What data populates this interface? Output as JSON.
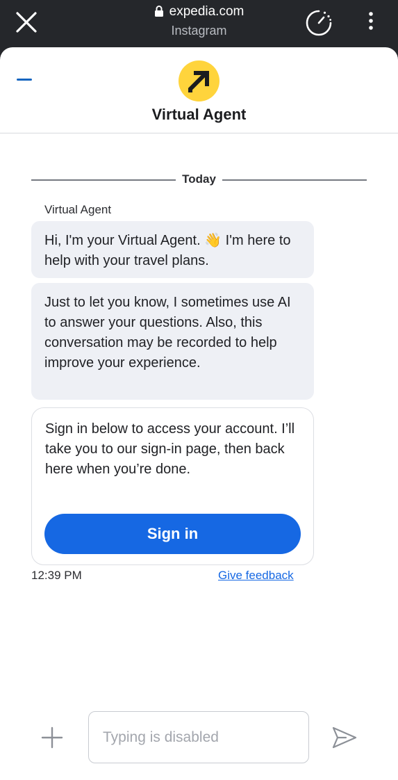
{
  "browser": {
    "domain": "expedia.com",
    "source_app": "Instagram"
  },
  "header": {
    "title": "Virtual Agent",
    "brand_color": "#ffd43c",
    "accent_color": "#1668e3"
  },
  "chat": {
    "date_divider": "Today",
    "sender_name": "Virtual Agent",
    "messages": [
      {
        "text": "Hi, I'm your Virtual Agent. 👋 I'm here to help with your travel plans."
      },
      {
        "text": "Just to let you know, I sometimes use AI to answer your questions. Also, this conversation may be recorded to help improve your experience."
      },
      {
        "text": "Sign in below to access your account. I’ll take you to our sign-in page, then back here when you’re done.",
        "button_label": "Sign in"
      }
    ],
    "timestamp": "12:39 PM",
    "feedback_link": "Give feedback"
  },
  "composer": {
    "placeholder": "Typing is disabled"
  }
}
